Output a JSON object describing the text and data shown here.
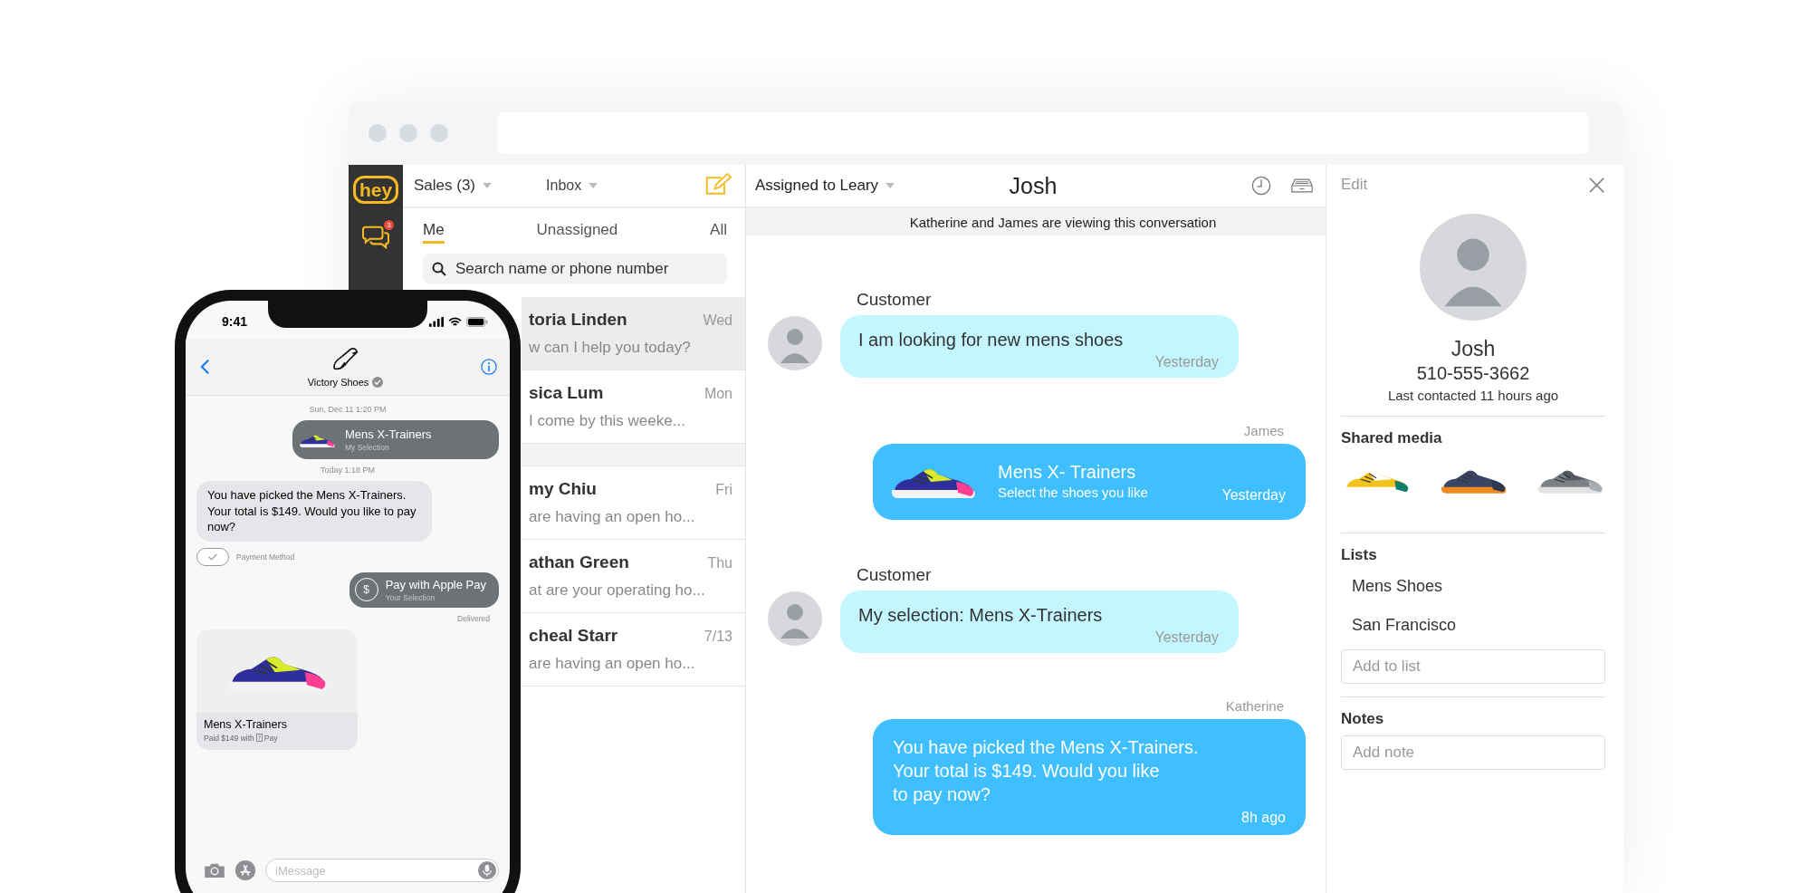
{
  "sidebar": {
    "logo": "hey",
    "chat_badge": "3"
  },
  "list_header": {
    "mailbox": "Sales (3)",
    "folder": "Inbox"
  },
  "tabs": [
    {
      "label": "Me",
      "selected": true
    },
    {
      "label": "Unassigned",
      "selected": false
    },
    {
      "label": "All",
      "selected": false
    }
  ],
  "search": {
    "placeholder": "Search name or phone number"
  },
  "conversation_groups": [
    {
      "items": [
        {
          "name": "toria Linden",
          "time": "Wed",
          "preview": "w can I help you today?",
          "selected": true
        },
        {
          "name": "sica Lum",
          "time": "Mon",
          "preview": "I come by this weeke...",
          "selected": false
        }
      ]
    },
    {
      "items": [
        {
          "name": "my Chiu",
          "time": "Fri",
          "preview": "are having an open ho...",
          "selected": false
        },
        {
          "name": "athan Green",
          "time": "Thu",
          "preview": "at are your operating ho...",
          "selected": false
        },
        {
          "name": "cheal Starr",
          "time": "7/13",
          "preview": "are having an open ho...",
          "selected": false
        }
      ]
    }
  ],
  "conversation": {
    "assignee": "Assigned to Leary",
    "title": "Josh",
    "banner": "Katherine and James are viewing this conversation",
    "messages": [
      {
        "kind": "incoming",
        "sender": "Customer",
        "text": "I am looking for new mens shoes",
        "time": "Yesterday"
      },
      {
        "kind": "product",
        "sender": "James",
        "title": "Mens X- Trainers",
        "subtitle": "Select the shoes you like",
        "time": "Yesterday"
      },
      {
        "kind": "incoming",
        "sender": "Customer",
        "text": "My selection: Mens X-Trainers",
        "time": "Yesterday"
      },
      {
        "kind": "outgoing",
        "sender": "Katherine",
        "text": "You have picked the Mens X-Trainers.\nYour total is $149. Would you like\nto pay now?",
        "time": "8h ago"
      }
    ]
  },
  "contact": {
    "edit": "Edit",
    "name": "Josh",
    "phone": "510-555-3662",
    "last_contacted": "Last contacted 11 hours ago",
    "shared_media_title": "Shared media",
    "lists_title": "Lists",
    "lists": [
      "Mens Shoes",
      "San Francisco"
    ],
    "add_list_placeholder": "Add to list",
    "notes_title": "Notes",
    "note_placeholder": "Add note"
  },
  "phone": {
    "time": "9:41",
    "contact": "Victory Shoes",
    "verified": true,
    "messages": [
      {
        "kind": "timestamp",
        "text": "Sun, Dec 11 1:20 PM"
      },
      {
        "kind": "selection",
        "title": "Mens X-Trainers",
        "subtitle": "My Selection"
      },
      {
        "kind": "timestamp",
        "text": "Today 1:18 PM"
      },
      {
        "kind": "received",
        "text": "You have picked the Mens X-Trainers.\nYour total is $149. Would you like to pay\nnow?"
      },
      {
        "kind": "action",
        "text": "Payment Method"
      },
      {
        "kind": "payment",
        "symbol": "$",
        "title": "Pay with Apple Pay",
        "subtitle": "Your Selection"
      },
      {
        "kind": "status",
        "text": "Delivered"
      },
      {
        "kind": "receipt",
        "title": "Mens X-Trainers",
        "paid": "Paid $149 with",
        "pay": "Pay"
      }
    ],
    "input_placeholder": "iMessage"
  }
}
